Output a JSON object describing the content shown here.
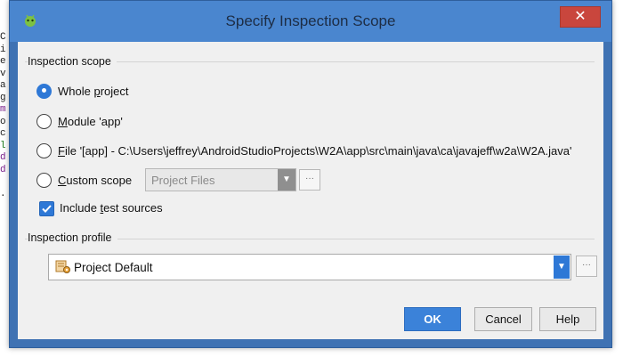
{
  "background_code": {
    "chars": [
      "C",
      "i",
      "e",
      "v",
      "a",
      "g",
      "m",
      "o",
      "c",
      "l",
      "d",
      "d",
      "",
      "."
    ]
  },
  "dialog": {
    "title": "Specify Inspection Scope",
    "close_label": "✕",
    "accent_color": "#3f72b3"
  },
  "scope": {
    "group_label": "Inspection scope",
    "options": {
      "whole_project": {
        "prefix": "Whole ",
        "mnemonic": "p",
        "suffix": "roject",
        "checked": true
      },
      "module": {
        "prefix": "",
        "mnemonic": "M",
        "suffix": "odule 'app'",
        "checked": false
      },
      "file": {
        "prefix": "",
        "mnemonic": "F",
        "suffix": "ile '[app] - C:\\Users\\jeffrey\\AndroidStudioProjects\\W2A\\app\\src\\main\\java\\ca\\javajeff\\w2a\\W2A.java'",
        "checked": false
      },
      "custom": {
        "prefix": "",
        "mnemonic": "C",
        "suffix": "ustom scope",
        "checked": false
      }
    },
    "custom_scope_value": "Project Files",
    "dots_label": "···",
    "include_tests": {
      "prefix": "Include ",
      "mnemonic": "t",
      "suffix": "est sources",
      "checked": true
    }
  },
  "profile": {
    "group_label": "Inspection profile",
    "selected": "Project Default",
    "dots_label": "···"
  },
  "buttons": {
    "ok": "OK",
    "cancel": "Cancel",
    "help": "Help"
  }
}
